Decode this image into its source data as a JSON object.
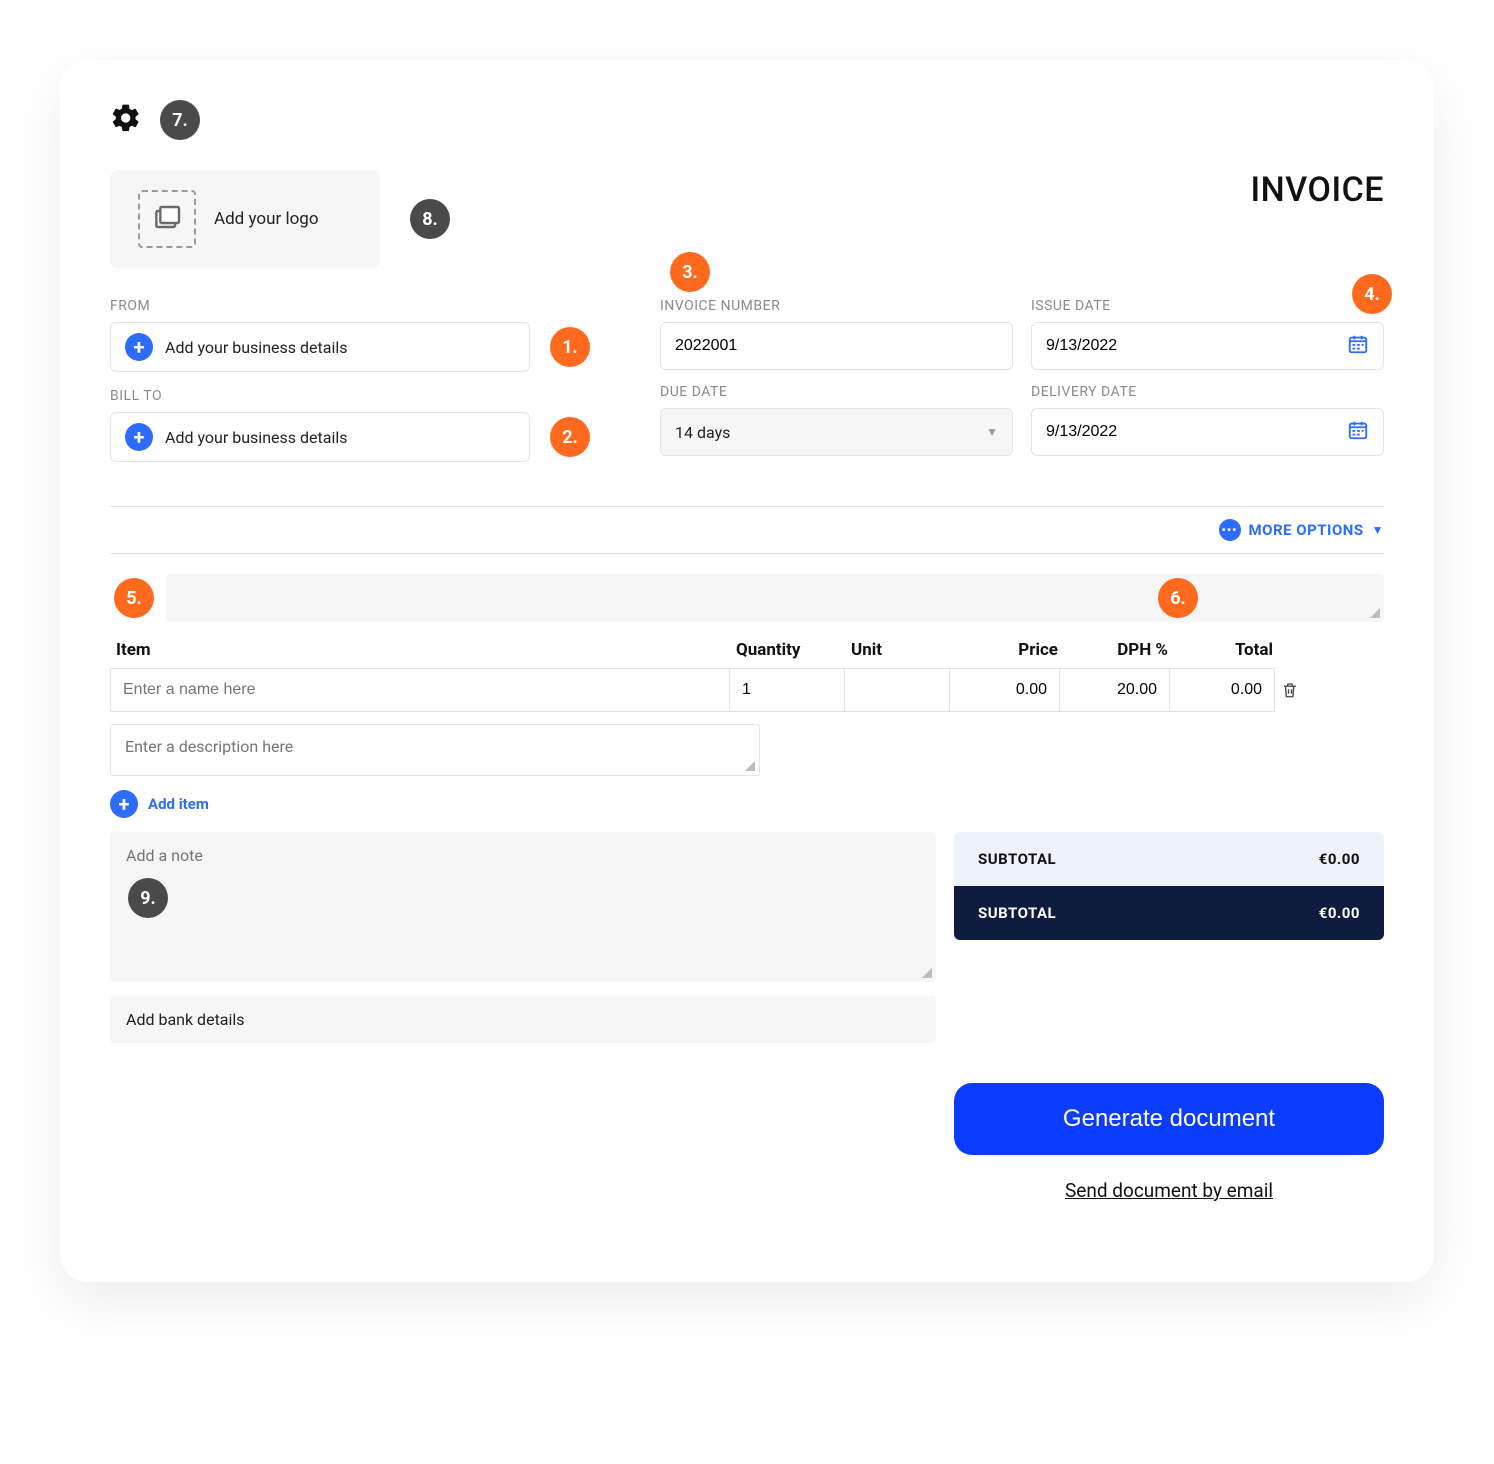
{
  "badges": {
    "b1": "1.",
    "b2": "2.",
    "b3": "3.",
    "b4": "4.",
    "b5": "5.",
    "b6": "6.",
    "b7": "7.",
    "b8": "8.",
    "b9": "9."
  },
  "header": {
    "logo_label": "Add your logo",
    "title": "INVOICE"
  },
  "parties": {
    "from_label": "FROM",
    "from_placeholder": "Add your business details",
    "billto_label": "BILL TO",
    "billto_placeholder": "Add your business details"
  },
  "dates": {
    "invoice_number_label": "INVOICE NUMBER",
    "invoice_number_value": "2022001",
    "issue_date_label": "ISSUE DATE",
    "issue_date_value": "9/13/2022",
    "due_date_label": "DUE DATE",
    "due_date_value": "14 days",
    "delivery_date_label": "DELIVERY DATE",
    "delivery_date_value": "9/13/2022"
  },
  "more_options": "MORE OPTIONS",
  "columns": {
    "item": "Item",
    "quantity": "Quantity",
    "unit": "Unit",
    "price": "Price",
    "dph": "DPH %",
    "total": "Total"
  },
  "row": {
    "name_placeholder": "Enter a name here",
    "quantity": "1",
    "unit": "",
    "price": "0.00",
    "dph": "20.00",
    "total": "0.00",
    "desc_placeholder": "Enter a description here"
  },
  "add_item": "Add item",
  "note_placeholder": "Add a note",
  "totals": {
    "subtotal_label": "SUBTOTAL",
    "subtotal_value": "€0.00",
    "grand_label": "SUBTOTAL",
    "grand_value": "€0.00"
  },
  "bank": "Add bank details",
  "actions": {
    "generate": "Generate document",
    "email": "Send document by email"
  }
}
